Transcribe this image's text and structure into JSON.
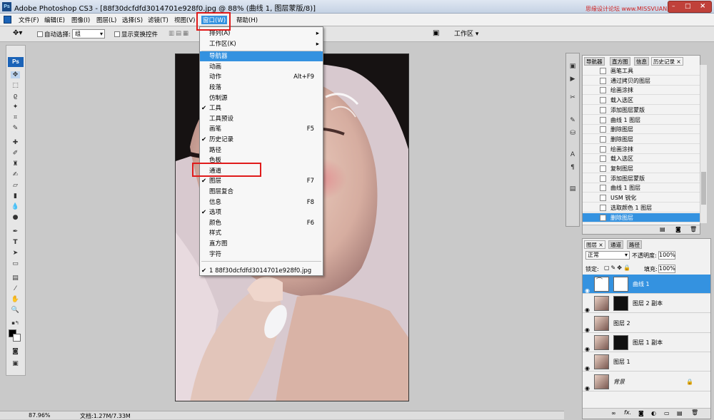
{
  "titlebar": {
    "app_icon": "Ps",
    "title": "Adobe Photoshop CS3 - [88f30dcfdfd3014701e928f0.jpg @ 88% (曲线 1, 图层蒙版/8)]",
    "watermark": "思缘设计论坛 www.MISSVUAN.COM"
  },
  "menubar": {
    "items": [
      "文件(F)",
      "编辑(E)",
      "图像(I)",
      "图层(L)",
      "选择(S)",
      "滤镜(T)",
      "视图(V)",
      "窗口(W)",
      "帮助(H)"
    ]
  },
  "options": {
    "auto_select": "自动选择:",
    "group_value": "组",
    "show_transform": "显示变换控件",
    "workspace": "工作区 ▾"
  },
  "window_menu": {
    "items": [
      {
        "label": "排列(A)",
        "submenu": true
      },
      {
        "label": "工作区(K)",
        "submenu": true
      },
      {
        "label": "导航器",
        "highlight": true
      },
      {
        "label": "动画"
      },
      {
        "label": "动作",
        "shortcut": "Alt+F9"
      },
      {
        "label": "段落"
      },
      {
        "label": "仿制源"
      },
      {
        "label": "工具",
        "checked": true
      },
      {
        "label": "工具预设"
      },
      {
        "label": "画笔",
        "shortcut": "F5"
      },
      {
        "label": "历史记录",
        "checked": true
      },
      {
        "label": "路径"
      },
      {
        "label": "色板"
      },
      {
        "label": "通道"
      },
      {
        "label": "图层",
        "checked": true,
        "shortcut": "F7"
      },
      {
        "label": "图层复合"
      },
      {
        "label": "信息",
        "shortcut": "F8"
      },
      {
        "label": "选项",
        "checked": true
      },
      {
        "label": "颜色",
        "shortcut": "F6"
      },
      {
        "label": "样式"
      },
      {
        "label": "直方图"
      },
      {
        "label": "字符"
      },
      {
        "label": "1 88f30dcfdfd3014701e928f0.jpg",
        "checked": true
      }
    ]
  },
  "history_panel": {
    "tabs": [
      "导航器",
      "直方图",
      "信息",
      "历史记录 ×"
    ],
    "items": [
      "画笔工具",
      "通过拷贝的图层",
      "绘画涂抹",
      "载入选区",
      "添加图层蒙版",
      "曲线 1 图层",
      "删除图层",
      "删除图层",
      "绘画涂抹",
      "载入选区",
      "复制图层",
      "添加图层蒙版",
      "曲线 1 图层",
      "USM 锐化",
      "选取颜色 1 图层",
      "删除图层"
    ],
    "selected_index": 15
  },
  "layers_panel": {
    "tabs": [
      "图层 ×",
      "通道",
      "路径"
    ],
    "blend_mode": "正常",
    "opacity_label": "不透明度:",
    "opacity_value": "100%",
    "lock_label": "锁定:",
    "fill_label": "填充:",
    "fill_value": "100%",
    "layers": [
      {
        "name": "曲线 1",
        "selected": true
      },
      {
        "name": "图层 2 副本"
      },
      {
        "name": "图层 2"
      },
      {
        "name": "图层 1 副本"
      },
      {
        "name": "图层 1"
      },
      {
        "name": "背景"
      }
    ]
  },
  "status": {
    "zoom": "87.96%",
    "doc": "文档:1.27M/7.33M"
  },
  "colors": {
    "highlight": "#3492e0",
    "annotation": "#e01b1b",
    "ps_blue": "#1b63b7"
  }
}
